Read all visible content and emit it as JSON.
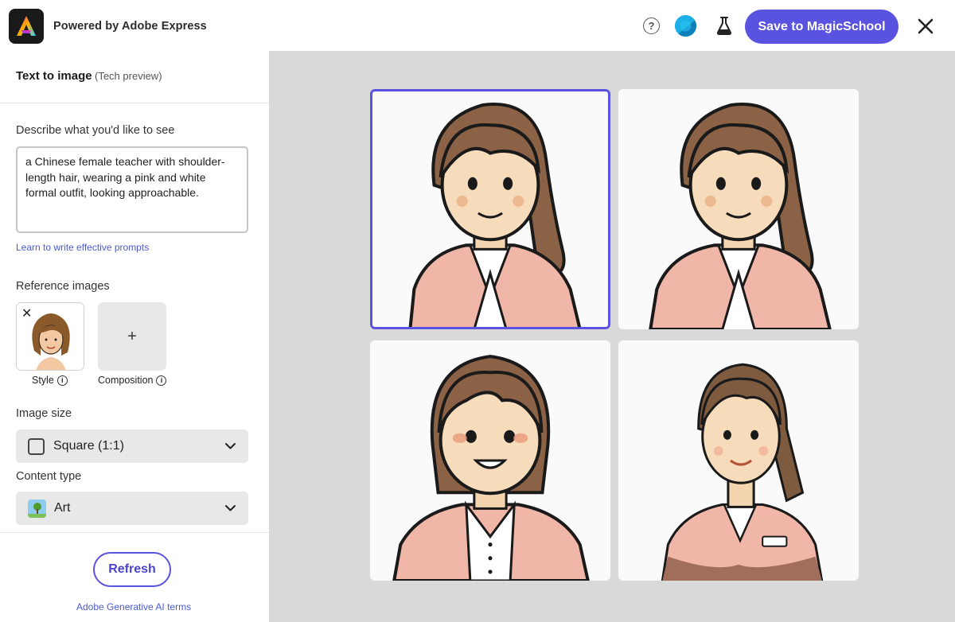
{
  "header": {
    "powered_by": "Powered by Adobe Express",
    "save_button": "Save to MagicSchool"
  },
  "panel": {
    "title": "Text to image",
    "subtitle": "(Tech preview)",
    "describe_label": "Describe what you'd like to see",
    "prompt_value": "a Chinese female teacher with shoulder-length hair, wearing a pink and white formal outfit, looking approachable.",
    "learn_link": "Learn to write effective prompts",
    "reference_label": "Reference images",
    "style_caption": "Style",
    "composition_caption": "Composition",
    "composition_plus": "+",
    "size_label": "Image size",
    "size_value": "Square (1:1)",
    "content_type_label": "Content type",
    "content_type_value": "Art",
    "refresh_button": "Refresh",
    "terms_link": "Adobe Generative AI terms"
  },
  "icons": {
    "help": "help-icon",
    "info": "i",
    "close_thumb": "✕"
  },
  "colors": {
    "accent": "#5a53e0",
    "link": "#4a5bd4",
    "canvas": "#d9d9d9"
  },
  "results": {
    "selected_index": 0,
    "count": 4
  }
}
